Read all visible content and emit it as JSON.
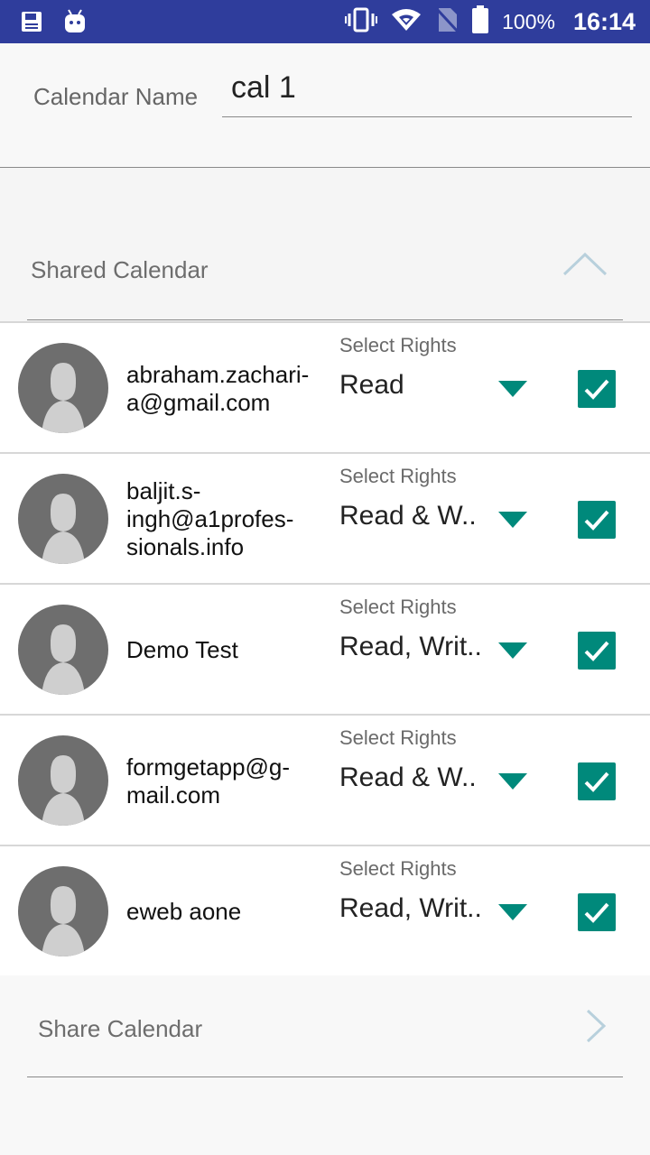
{
  "status_bar": {
    "battery": "100%",
    "time": "16:14"
  },
  "form": {
    "name_label": "Calendar Name",
    "name_value": "cal 1"
  },
  "shared": {
    "title": "Shared Calendar",
    "rows": [
      {
        "email": "abraham.zachari-\na@gmail.com",
        "rights_label": "Select Rights",
        "rights": "Read",
        "checked": true
      },
      {
        "email": "baljit.s-\ningh@a1profes-\nsionals.info",
        "rights_label": "Select Rights",
        "rights": "Read & W..",
        "checked": true
      },
      {
        "email": "Demo Test",
        "rights_label": "Select Rights",
        "rights": "Read, Writ..",
        "checked": true
      },
      {
        "email": "formgetapp@g-\nmail.com",
        "rights_label": "Select Rights",
        "rights": "Read & W..",
        "checked": true
      },
      {
        "email": "eweb aone",
        "rights_label": "Select Rights",
        "rights": "Read, Writ..",
        "checked": true
      }
    ]
  },
  "share": {
    "label": "Share Calendar"
  },
  "colors": {
    "status_bar": "#2f3d9c",
    "accent": "#00897b"
  },
  "icons": {
    "status_left": [
      "save-icon",
      "android-icon"
    ],
    "status_right": [
      "vibrate-icon",
      "wifi-icon",
      "no-sim-icon",
      "battery-icon"
    ]
  }
}
